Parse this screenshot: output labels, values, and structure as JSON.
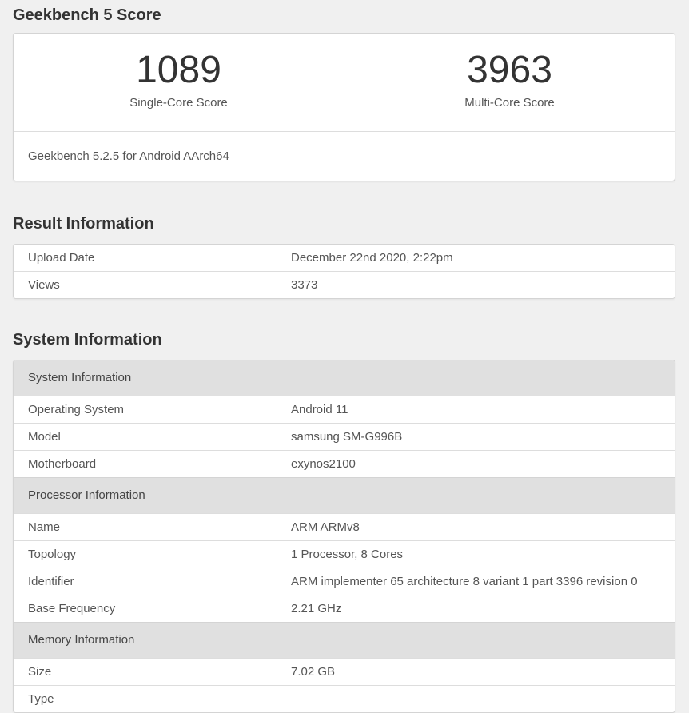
{
  "page_title": "Geekbench 5 Score",
  "score_card": {
    "scores": [
      {
        "value": "1089",
        "label": "Single-Core Score"
      },
      {
        "value": "3963",
        "label": "Multi-Core Score"
      }
    ],
    "footnote": "Geekbench 5.2.5 for Android AArch64"
  },
  "result_information": {
    "heading": "Result Information",
    "rows": [
      {
        "label": "Upload Date",
        "value": "December 22nd 2020, 2:22pm"
      },
      {
        "label": "Views",
        "value": "3373"
      }
    ]
  },
  "system_information": {
    "heading": "System Information",
    "groups": [
      {
        "header": "System Information",
        "rows": [
          {
            "label": "Operating System",
            "value": "Android 11"
          },
          {
            "label": "Model",
            "value": "samsung SM-G996B"
          },
          {
            "label": "Motherboard",
            "value": "exynos2100"
          }
        ]
      },
      {
        "header": "Processor Information",
        "rows": [
          {
            "label": "Name",
            "value": "ARM ARMv8"
          },
          {
            "label": "Topology",
            "value": "1 Processor, 8 Cores"
          },
          {
            "label": "Identifier",
            "value": "ARM implementer 65 architecture 8 variant 1 part 3396 revision 0"
          },
          {
            "label": "Base Frequency",
            "value": "2.21 GHz"
          }
        ]
      },
      {
        "header": "Memory Information",
        "rows": [
          {
            "label": "Size",
            "value": "7.02 GB"
          },
          {
            "label": "Type",
            "value": ""
          }
        ]
      }
    ]
  },
  "colors": {
    "page_background": "#f0f0f0",
    "panel_background": "#ffffff",
    "panel_border": "#d4d4d4",
    "row_divider": "#dddddd",
    "group_header_background": "#e0e0e0",
    "heading_text": "#333333",
    "body_text": "#555555"
  }
}
